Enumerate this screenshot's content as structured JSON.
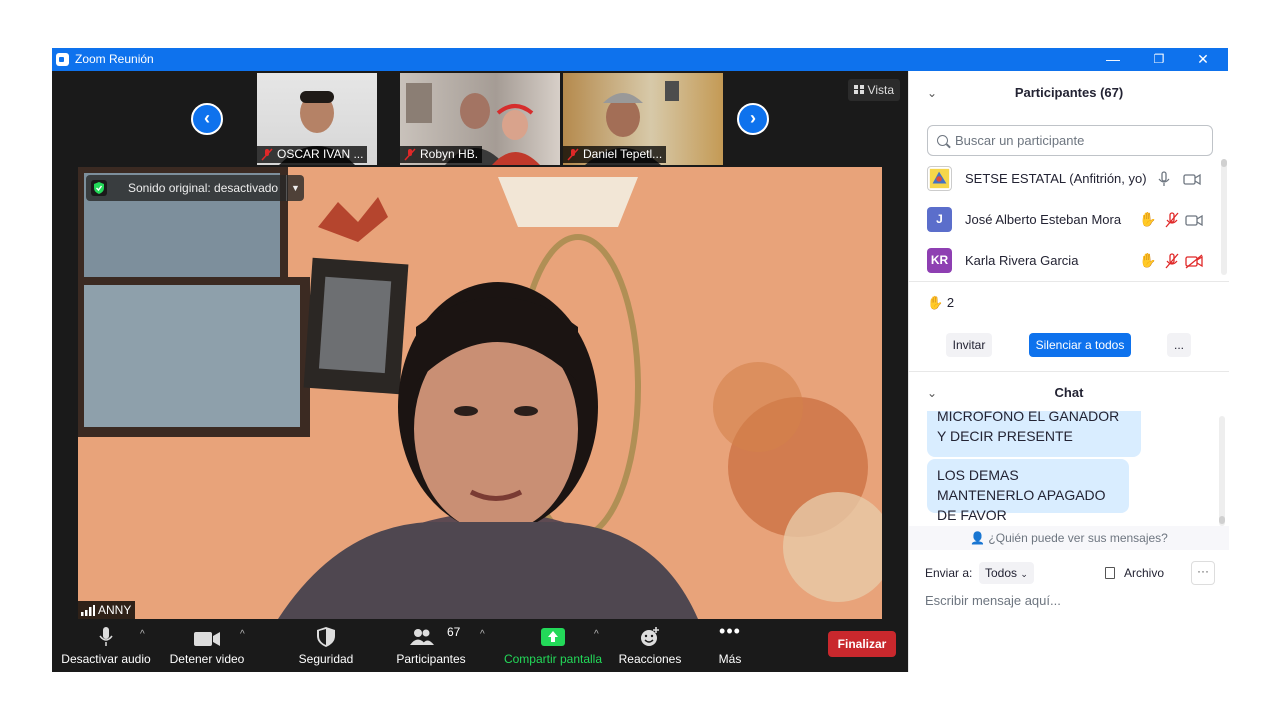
{
  "window": {
    "title": "Zoom Reunión"
  },
  "thumbnails": [
    {
      "name": "OSCAR IVAN ..."
    },
    {
      "name": "Robyn HB."
    },
    {
      "name": "Daniel Tepetl..."
    }
  ],
  "view_button": {
    "label": "Vista"
  },
  "main_video": {
    "sound_label": "Sonido original: desactivado",
    "speaker_name": "ANNY"
  },
  "toolbar": {
    "audio": "Desactivar audio",
    "video": "Detener video",
    "security": "Seguridad",
    "participants": "Participantes",
    "participants_count": "67",
    "share": "Compartir pantalla",
    "reactions": "Reacciones",
    "more": "Más",
    "end": "Finalizar"
  },
  "participants_panel": {
    "title": "Participantes (67)",
    "search_placeholder": "Buscar un participante",
    "participants": [
      {
        "name": "SETSE ESTATAL (Anfitrión, yo)",
        "avatar_initials": "",
        "avatar_color": "#f6d64a"
      },
      {
        "name": "José Alberto Esteban Mora",
        "avatar_initials": "J",
        "avatar_color": "#5b6ecb"
      },
      {
        "name": "Karla Rivera Garcia",
        "avatar_initials": "KR",
        "avatar_color": "#8e3fb2"
      }
    ],
    "hands_raised": "2",
    "invite": "Invitar",
    "mute_all": "Silenciar a todos",
    "more": "..."
  },
  "chat": {
    "title": "Chat",
    "messages": [
      {
        "text": "MICROFONO EL GANADOR Y DECIR PRESENTE"
      },
      {
        "text": "LOS DEMAS MANTENERLO APAGADO DE FAVOR"
      }
    ],
    "who_can_see": "¿Quién puede ver sus mensajes?",
    "send_to_label": "Enviar a:",
    "send_to_value": "Todos",
    "file_label": "Archivo",
    "input_placeholder": "Escribir mensaje aquí..."
  },
  "colors": {
    "accent": "#0e72ed",
    "end": "#c9282d",
    "share": "#23d959"
  }
}
